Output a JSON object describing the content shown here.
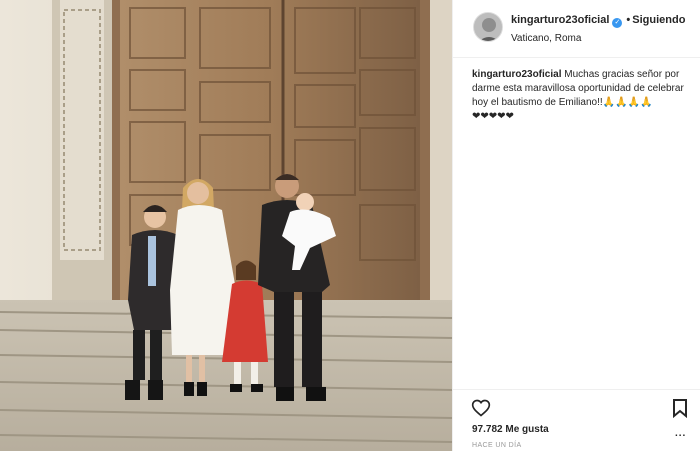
{
  "post": {
    "username": "kingarturo23oficial",
    "separator": "•",
    "follow_label": "Siguiendo",
    "location": "Vaticano, Roma",
    "caption_user": "kingarturo23oficial",
    "caption_text": "Muchas gracias señor por darme esta maravillosa oportunidad de celebrar hoy el bautismo de Emiliano!!🙏🙏🙏🙏",
    "caption_hearts": "❤︎❤︎❤︎❤︎❤︎",
    "likes": "97.782 Me gusta",
    "timestamp": "HACE UN DÍA",
    "more_label": "..."
  },
  "colors": {
    "verified_badge": "#3897f0",
    "door": "#9e7a56",
    "stone": "#d9d2c3"
  },
  "icons": {
    "like": "heart-icon",
    "save": "bookmark-icon",
    "verified": "verified-badge-icon"
  }
}
